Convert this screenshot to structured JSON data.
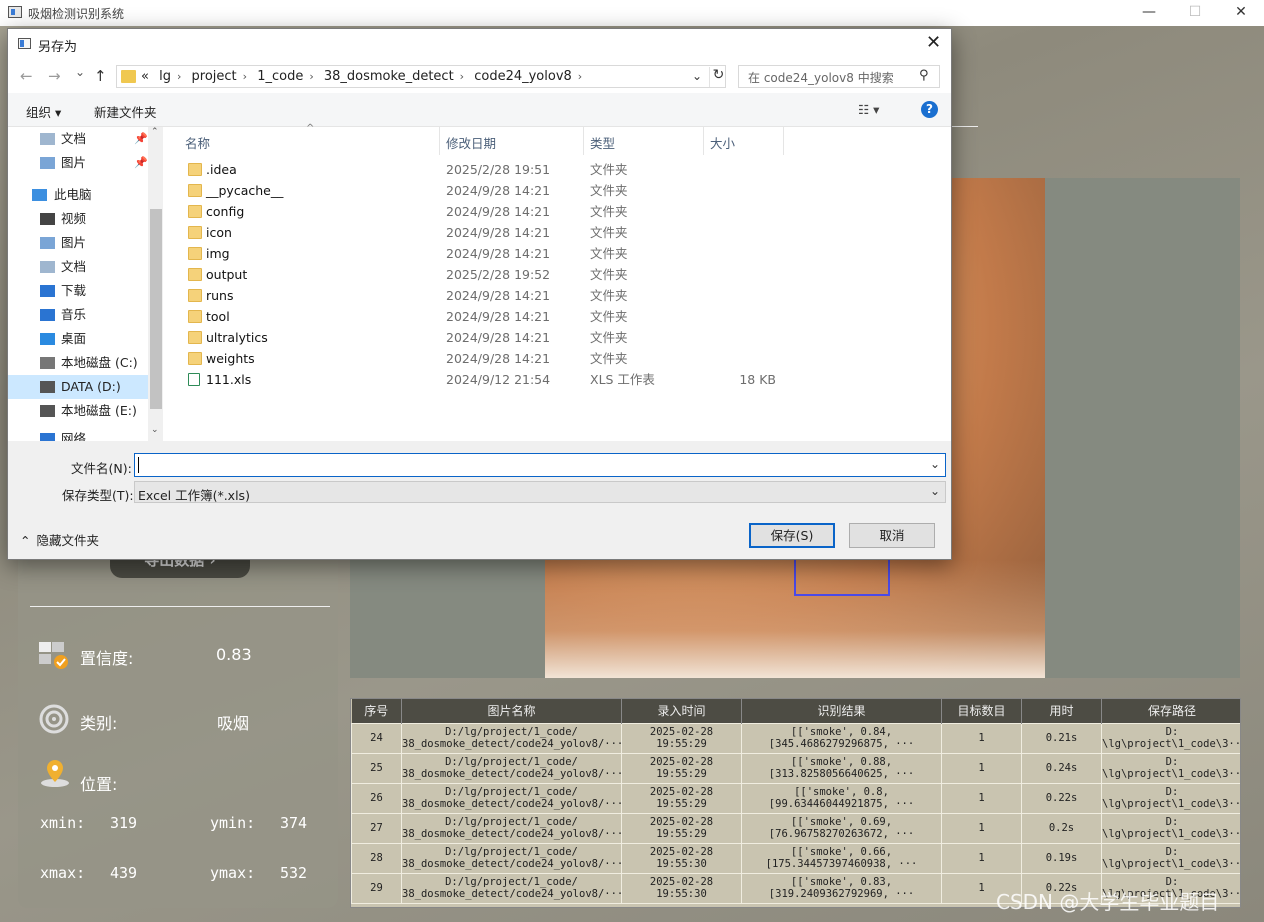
{
  "window": {
    "title": "吸烟检测识别系统",
    "minimize": "—",
    "maximize": "☐",
    "close": "✕"
  },
  "app": {
    "export_button": "导出数据 ›",
    "confidence_label": "置信度:",
    "confidence_value": "0.83",
    "class_label": "类别:",
    "class_value": "吸烟",
    "position_label": "位置:",
    "xmin_label": "xmin:",
    "xmin_value": "319",
    "ymin_label": "ymin:",
    "ymin_value": "374",
    "xmax_label": "xmax:",
    "xmax_value": "439",
    "ymax_label": "ymax:",
    "ymax_value": "532"
  },
  "table": {
    "headers": [
      "序号",
      "图片名称",
      "录入时间",
      "识别结果",
      "目标数目",
      "用时",
      "保存路径"
    ],
    "rows": [
      {
        "id": "24",
        "name1": "D:/lg/project/1_code/",
        "name2": "38_dosmoke_detect/code24_yolov8/···",
        "date": "2025-02-28",
        "time": "19:55:29",
        "r1": "[['smoke', 0.84,",
        "r2": "[345.4686279296875, ···",
        "count": "1",
        "dur": "0.21s",
        "p1": "D:",
        "p2": "\\lg\\project\\1_code\\3···"
      },
      {
        "id": "25",
        "name1": "D:/lg/project/1_code/",
        "name2": "38_dosmoke_detect/code24_yolov8/···",
        "date": "2025-02-28",
        "time": "19:55:29",
        "r1": "[['smoke', 0.88,",
        "r2": "[313.8258056640625, ···",
        "count": "1",
        "dur": "0.24s",
        "p1": "D:",
        "p2": "\\lg\\project\\1_code\\3···"
      },
      {
        "id": "26",
        "name1": "D:/lg/project/1_code/",
        "name2": "38_dosmoke_detect/code24_yolov8/···",
        "date": "2025-02-28",
        "time": "19:55:29",
        "r1": "[['smoke', 0.8,",
        "r2": "[99.63446044921875, ···",
        "count": "1",
        "dur": "0.22s",
        "p1": "D:",
        "p2": "\\lg\\project\\1_code\\3···"
      },
      {
        "id": "27",
        "name1": "D:/lg/project/1_code/",
        "name2": "38_dosmoke_detect/code24_yolov8/···",
        "date": "2025-02-28",
        "time": "19:55:29",
        "r1": "[['smoke', 0.69,",
        "r2": "[76.96758270263672, ···",
        "count": "1",
        "dur": "0.2s",
        "p1": "D:",
        "p2": "\\lg\\project\\1_code\\3···"
      },
      {
        "id": "28",
        "name1": "D:/lg/project/1_code/",
        "name2": "38_dosmoke_detect/code24_yolov8/···",
        "date": "2025-02-28",
        "time": "19:55:30",
        "r1": "[['smoke', 0.66,",
        "r2": "[175.34457397460938, ···",
        "count": "1",
        "dur": "0.19s",
        "p1": "D:",
        "p2": "\\lg\\project\\1_code\\3···"
      },
      {
        "id": "29",
        "name1": "D:/lg/project/1_code/",
        "name2": "38_dosmoke_detect/code24_yolov8/···",
        "date": "2025-02-28",
        "time": "19:55:30",
        "r1": "[['smoke', 0.83,",
        "r2": "[319.2409362792969, ···",
        "count": "1",
        "dur": "0.22s",
        "p1": "D:",
        "p2": "\\lg\\project\\1_code\\3···"
      }
    ]
  },
  "dialog": {
    "title": "另存为",
    "close": "✕",
    "back": "←",
    "forward": "→",
    "down": "⌄",
    "up": "↑",
    "breadcrumb": [
      "«",
      "lg",
      "project",
      "1_code",
      "38_dosmoke_detect",
      "code24_yolov8"
    ],
    "search_placeholder": "在 code24_yolov8 中搜索",
    "organize": "组织 ▾",
    "new_folder": "新建文件夹",
    "view": "☷ ▾",
    "help": "?",
    "nav_items": [
      {
        "label": "文档",
        "icon": "document-icon",
        "pinned": true
      },
      {
        "label": "图片",
        "icon": "pictures-icon",
        "pinned": true
      },
      {
        "label": "此电脑",
        "icon": "computer-icon",
        "pinned": false
      },
      {
        "label": "视频",
        "icon": "video-icon",
        "pinned": false
      },
      {
        "label": "图片",
        "icon": "pictures-icon",
        "pinned": false
      },
      {
        "label": "文档",
        "icon": "document-icon",
        "pinned": false
      },
      {
        "label": "下载",
        "icon": "download-icon",
        "pinned": false
      },
      {
        "label": "音乐",
        "icon": "music-icon",
        "pinned": false
      },
      {
        "label": "桌面",
        "icon": "desktop-icon",
        "pinned": false
      },
      {
        "label": "本地磁盘 (C:)",
        "icon": "drive-c-icon",
        "pinned": false
      },
      {
        "label": "DATA (D:)",
        "icon": "drive-icon",
        "pinned": false
      },
      {
        "label": "本地磁盘 (E:)",
        "icon": "drive-icon",
        "pinned": false
      },
      {
        "label": "网络",
        "icon": "network-icon",
        "pinned": false
      }
    ],
    "columns": {
      "name": "名称",
      "date": "修改日期",
      "type": "类型",
      "size": "大小"
    },
    "files": [
      {
        "name": ".idea",
        "date": "2025/2/28 19:51",
        "type": "文件夹",
        "size": ""
      },
      {
        "name": "__pycache__",
        "date": "2024/9/28 14:21",
        "type": "文件夹",
        "size": ""
      },
      {
        "name": "config",
        "date": "2024/9/28 14:21",
        "type": "文件夹",
        "size": ""
      },
      {
        "name": "icon",
        "date": "2024/9/28 14:21",
        "type": "文件夹",
        "size": ""
      },
      {
        "name": "img",
        "date": "2024/9/28 14:21",
        "type": "文件夹",
        "size": ""
      },
      {
        "name": "output",
        "date": "2025/2/28 19:52",
        "type": "文件夹",
        "size": ""
      },
      {
        "name": "runs",
        "date": "2024/9/28 14:21",
        "type": "文件夹",
        "size": ""
      },
      {
        "name": "tool",
        "date": "2024/9/28 14:21",
        "type": "文件夹",
        "size": ""
      },
      {
        "name": "ultralytics",
        "date": "2024/9/28 14:21",
        "type": "文件夹",
        "size": ""
      },
      {
        "name": "weights",
        "date": "2024/9/28 14:21",
        "type": "文件夹",
        "size": ""
      },
      {
        "name": "111.xls",
        "date": "2024/9/12 21:54",
        "type": "XLS 工作表",
        "size": "18 KB"
      }
    ],
    "filename_label": "文件名(N):",
    "filename_value": "",
    "filetype_label": "保存类型(T):",
    "filetype_value": "Excel 工作簿(*.xls)",
    "hide_folders": "隐藏文件夹",
    "save": "保存(S)",
    "cancel": "取消"
  },
  "watermark": "CSDN @大学生毕业题目"
}
